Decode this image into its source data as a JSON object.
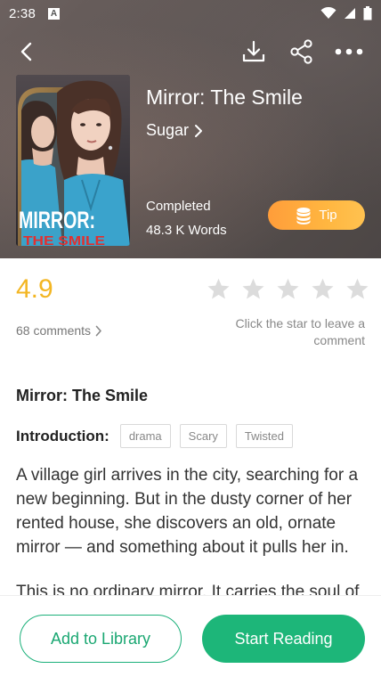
{
  "status_bar": {
    "time": "2:38",
    "notification_letter": "A"
  },
  "header": {
    "back_icon": "back-arrow-icon",
    "download_icon": "download-icon",
    "share_icon": "share-icon",
    "more_icon": "more-dots-icon"
  },
  "book": {
    "title": "Mirror: The Smile",
    "author": "Sugar",
    "status": "Completed",
    "words": "48.3 K Words",
    "cover_title_line1": "MIRROR:",
    "cover_title_line2": "THE SMILE"
  },
  "tip": {
    "label": "Tip",
    "icon": "coins-icon",
    "color": "#ffa83a"
  },
  "rating": {
    "value": "4.9",
    "comments": "68 comments",
    "hint": "Click the star to leave a comment",
    "stars_total": 5,
    "stars_filled": 0,
    "color": "#f3b623"
  },
  "details": {
    "title": "Mirror: The Smile",
    "intro_label": "Introduction:",
    "tags": [
      "drama",
      "Scary",
      "Twisted"
    ],
    "paragraphs": [
      "A village girl arrives in the city, searching for a new beginning. But in the dusty corner of her rented house, she discovers an old, ornate mirror — and something about it pulls her in.",
      "This is no ordinary mirror. It carries the soul of"
    ]
  },
  "actions": {
    "add_to_library": "Add to Library",
    "start_reading": "Start Reading",
    "accent": "#1db679"
  }
}
